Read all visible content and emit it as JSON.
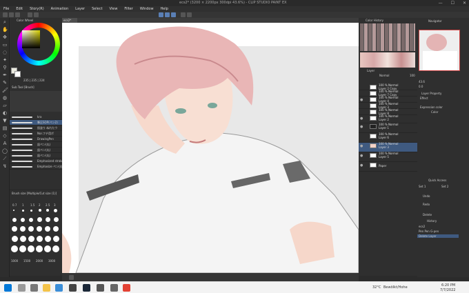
{
  "window": {
    "title": "ecs2* (3200 × 2200px 300dpi 43.6%) - CLIP STUDIO PAINT EX",
    "min": "—",
    "max": "☐",
    "close": "✕"
  },
  "menu": [
    "File",
    "Edit",
    "Story(R)",
    "Animation",
    "Layer",
    "Select",
    "View",
    "Filter",
    "Window",
    "Help"
  ],
  "canvas": {
    "tab": "ecs2*"
  },
  "color_panel": {
    "title": "Color Wheel",
    "values": "235 | 235 | 224"
  },
  "brushes": {
    "title": "Sub Tool [Brush]",
    "items": [
      "kra",
      "筆圧SOP(ペン2)",
      "肌塗り ぬれたウ",
      "Nor.フチ用ボ",
      "DrawingPen",
      "鉛ペン(丸)",
      "鉛ペン(丸)",
      "鉛ペン(丸)",
      "Emphasized strokes",
      "Emphasize ペン(丸)"
    ]
  },
  "brush_size": {
    "title": "Brush size [Multiple/Cut size (1)]",
    "labels": [
      "0.7",
      "1",
      "1.5",
      "2",
      "2.5",
      "3",
      "1000",
      "1500",
      "2000",
      "3000"
    ]
  },
  "color_history": {
    "title": "Color History"
  },
  "layers": {
    "title": "Layer",
    "blend": "Normal",
    "opacity": "100",
    "items": [
      {
        "mode": "100 % Normal",
        "name": "Layer 2 Copy"
      },
      {
        "mode": "100 % Normal",
        "name": "Layer 7 Copy"
      },
      {
        "mode": "100 % Normal",
        "name": "Layer 4"
      },
      {
        "mode": "100 % Normal",
        "name": "Layer 3"
      },
      {
        "mode": "100 % Normal",
        "name": "Layer 8"
      },
      {
        "mode": "100 % Normal",
        "name": "Layer 2"
      },
      {
        "mode": "100 % Normal",
        "name": "Layer 1"
      },
      {
        "mode": "100 % Normal",
        "name": "Layer 6"
      },
      {
        "mode": "100 % Normal",
        "name": "Layer 3"
      },
      {
        "mode": "100 % Normal",
        "name": "Layer 5"
      },
      {
        "mode": "",
        "name": "Paper"
      }
    ]
  },
  "navigator": {
    "title": "Navigator",
    "zoom": "43.6",
    "angle": "0.0"
  },
  "layer_property": {
    "title": "Layer Property",
    "effect": "Effect",
    "expression": "Expression color",
    "color": "Color"
  },
  "quick_access": {
    "title": "Quick Access",
    "set1": "Set 1",
    "set2": "Set 2"
  },
  "history": {
    "title": "Undo",
    "redo": "Redo",
    "delete": "Delete"
  },
  "history_list": {
    "title": "History",
    "items": [
      "ecs2",
      "Pen Pen G-pen",
      "Delete Layer"
    ]
  },
  "taskbar": {
    "temp": "32°C",
    "weather": "Bewölkt/Hohe",
    "time": "6:20 PM",
    "date": "7/7/2022"
  }
}
